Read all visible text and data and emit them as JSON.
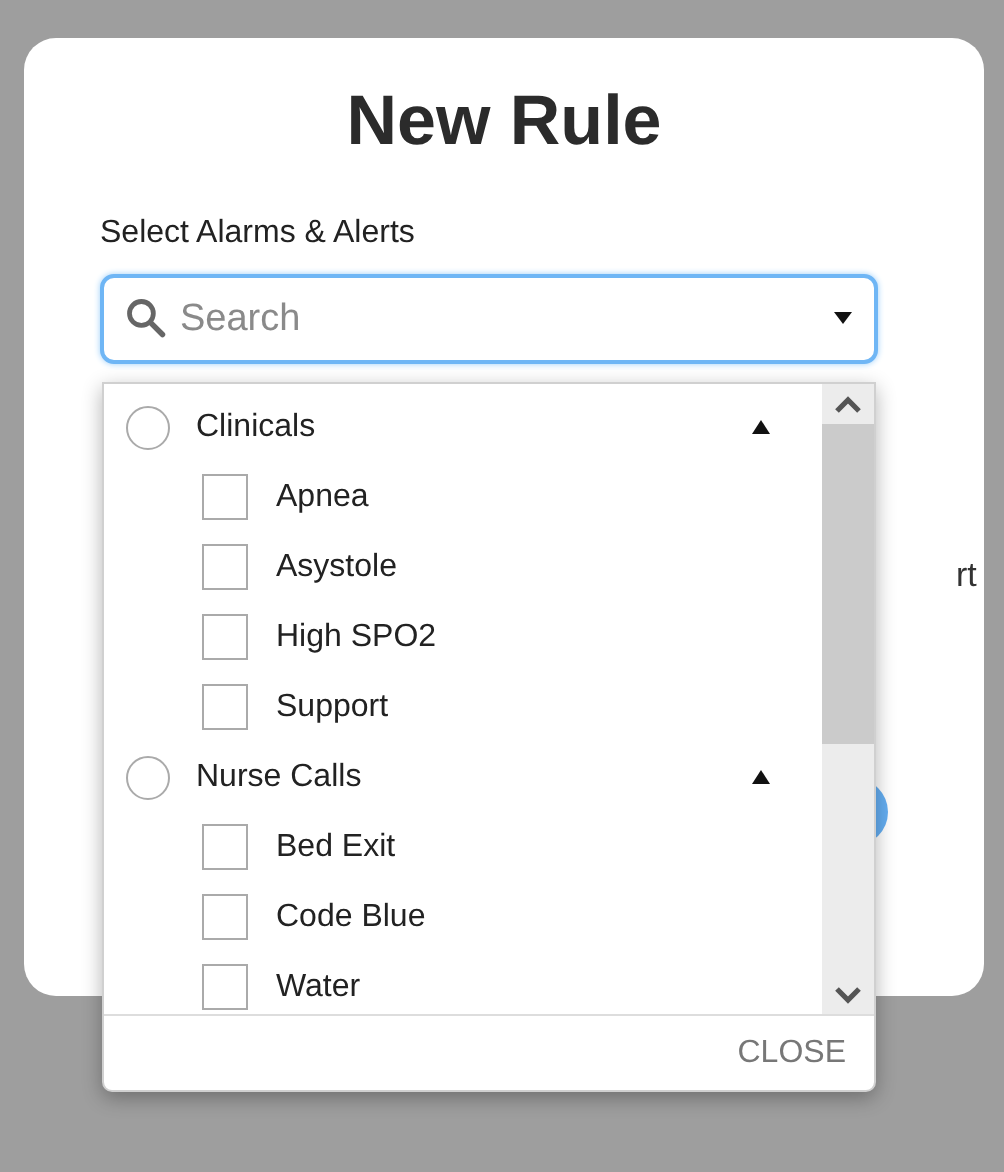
{
  "dialog": {
    "title": "New Rule",
    "field_label": "Select Alarms & Alerts",
    "search": {
      "placeholder": "Search"
    },
    "background_text": "rt"
  },
  "dropdown": {
    "groups": [
      {
        "label": "Clinicals",
        "selected": false,
        "expanded": true,
        "children": [
          {
            "label": "Apnea",
            "checked": false
          },
          {
            "label": "Asystole",
            "checked": false
          },
          {
            "label": "High SPO2",
            "checked": false
          },
          {
            "label": "Support",
            "checked": false
          }
        ]
      },
      {
        "label": "Nurse Calls",
        "selected": false,
        "expanded": true,
        "children": [
          {
            "label": "Bed Exit",
            "checked": false
          },
          {
            "label": "Code Blue",
            "checked": false
          },
          {
            "label": "Water",
            "checked": false
          }
        ]
      }
    ],
    "close_label": "CLOSE"
  }
}
